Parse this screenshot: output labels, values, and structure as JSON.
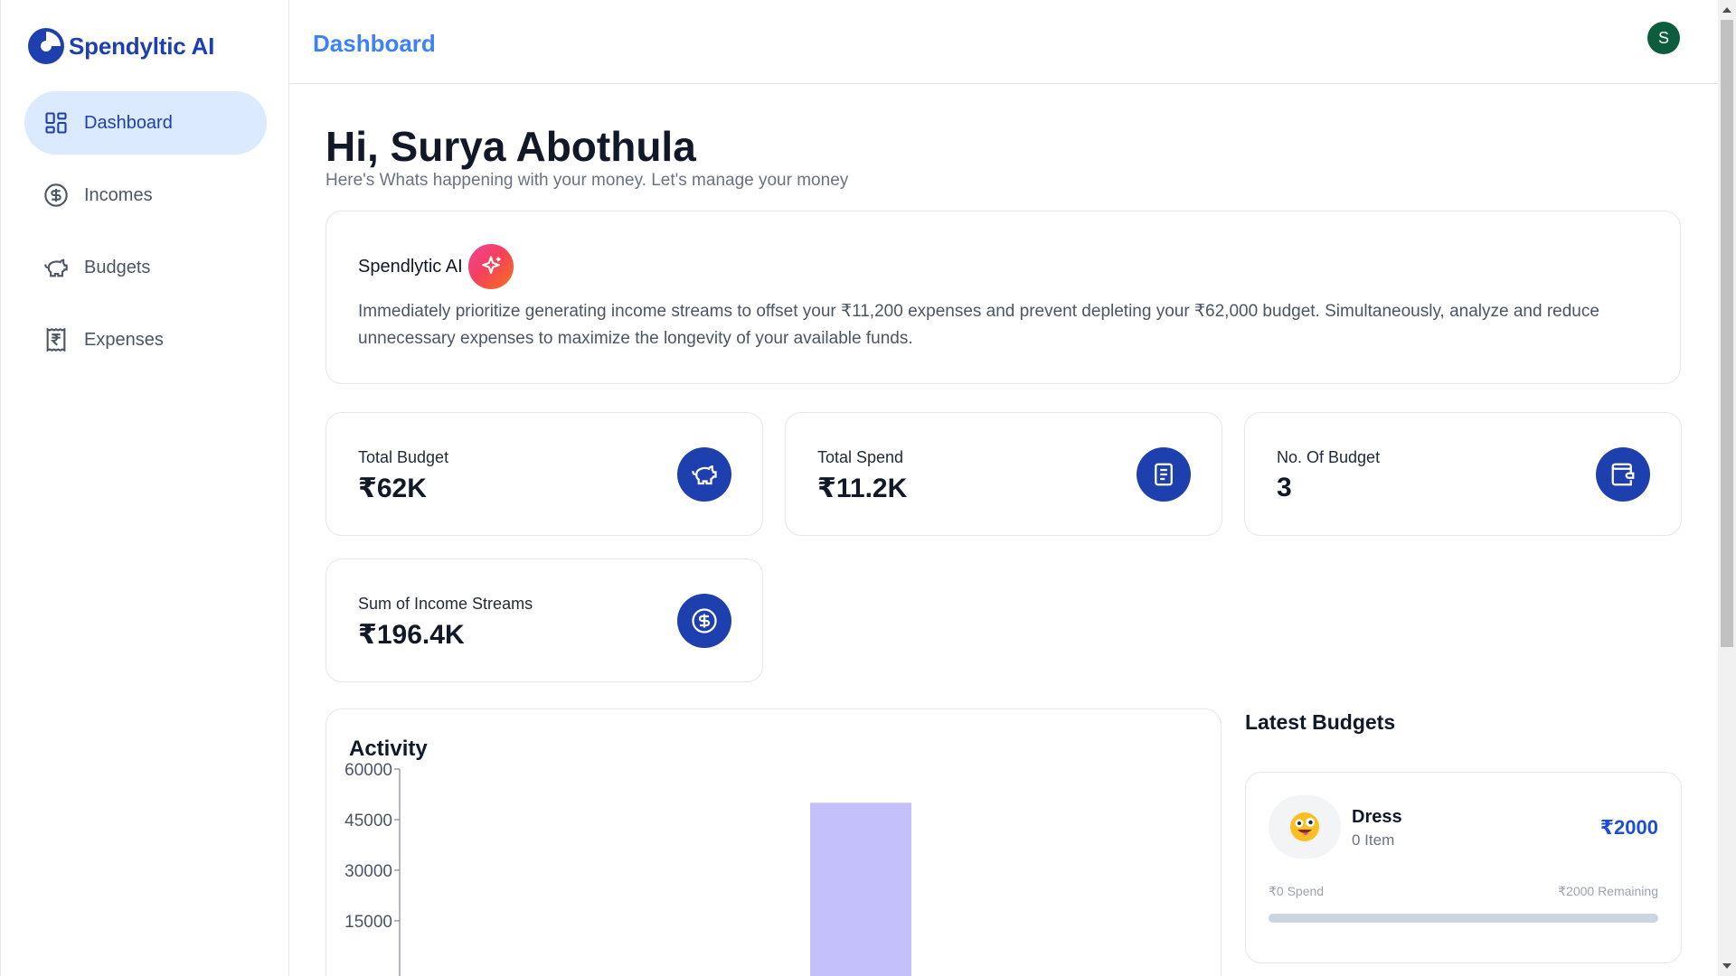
{
  "app": {
    "name": "Spendyltic AI"
  },
  "sidebar": {
    "items": [
      {
        "label": "Dashboard",
        "icon": "layout-grid-icon",
        "active": true
      },
      {
        "label": "Incomes",
        "icon": "dollar-circle-icon",
        "active": false
      },
      {
        "label": "Budgets",
        "icon": "piggy-bank-icon",
        "active": false
      },
      {
        "label": "Expenses",
        "icon": "receipt-rupee-icon",
        "active": false
      }
    ]
  },
  "header": {
    "title": "Dashboard",
    "avatar_initial": "S"
  },
  "main": {
    "greeting": "Hi, Surya Abothula",
    "subtitle": "Here's Whats happening with your money. Let's manage your money",
    "ai_card": {
      "title": "Spendlytic AI",
      "text": "Immediately prioritize generating income streams to offset your ₹11,200 expenses and prevent depleting your ₹62,000 budget. Simultaneously, analyze and reduce unnecessary expenses to maximize the longevity of your available funds."
    },
    "stats": [
      {
        "label": "Total Budget",
        "value": "₹62K",
        "icon": "piggy-bank-icon"
      },
      {
        "label": "Total Spend",
        "value": "₹11.2K",
        "icon": "receipt-icon"
      },
      {
        "label": "No. Of Budget",
        "value": "3",
        "icon": "wallet-icon"
      },
      {
        "label": "Sum of Income Streams",
        "value": "₹196.4K",
        "icon": "dollar-circle-icon"
      }
    ],
    "activity": {
      "title": "Activity"
    },
    "latest_budgets": {
      "title": "Latest Budgets",
      "items": [
        {
          "name": "Dress",
          "items": "0 Item",
          "amount": "₹2000",
          "spend": "₹0 Spend",
          "remaining": "₹2000 Remaining",
          "progress": 0,
          "emoji": "😜"
        }
      ]
    }
  },
  "colors": {
    "brand": "#1e40af",
    "accent": "#3b82f6",
    "bar": "#c4c0fb",
    "avatar": "#0b5d3b"
  },
  "chart_data": {
    "type": "bar",
    "title": "Activity",
    "yticks": [
      "60000",
      "45000",
      "30000",
      "15000"
    ],
    "ylim": [
      0,
      60000
    ],
    "series": [
      {
        "values": [
          50000
        ]
      }
    ]
  }
}
